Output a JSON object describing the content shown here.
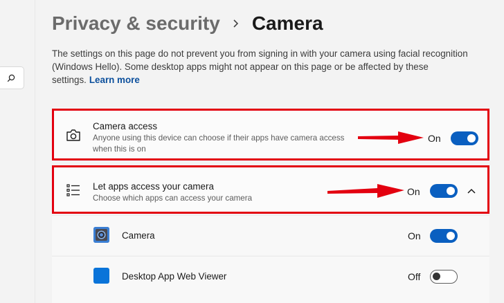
{
  "header": {
    "parent": "Privacy & security",
    "current": "Camera"
  },
  "description": {
    "text": "The settings on this page do not prevent you from signing in with your camera using facial recognition (Windows Hello). Some desktop apps might not appear on this page or be affected by these settings.",
    "link": "Learn more"
  },
  "camera_access": {
    "title": "Camera access",
    "subtitle": "Anyone using this device can choose if their apps have camera access when this is on",
    "state": "On",
    "icon": "camera-icon"
  },
  "let_apps": {
    "title": "Let apps access your camera",
    "subtitle": "Choose which apps can access your camera",
    "state": "On",
    "icon": "list-icon"
  },
  "apps": [
    {
      "name": "Camera",
      "state": "On",
      "icon": "camera-app-icon"
    },
    {
      "name": "Desktop App Web Viewer",
      "state": "Off",
      "icon": "desktop-app-web-viewer-icon"
    }
  ],
  "colors": {
    "accent": "#0a5fc0",
    "highlight": "#e3000f",
    "link": "#0b4f9c"
  }
}
